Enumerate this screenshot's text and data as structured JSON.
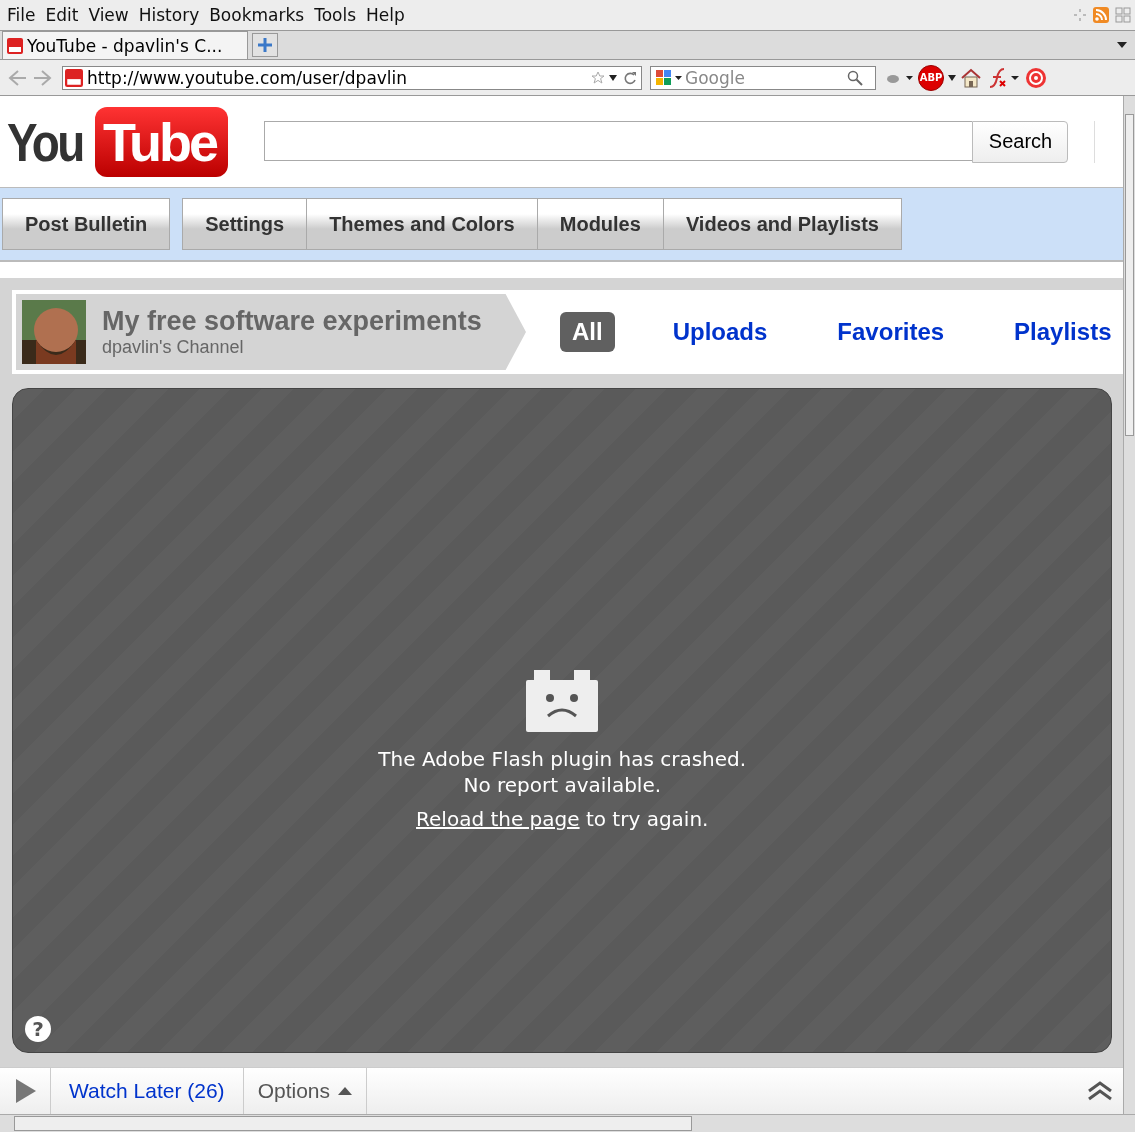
{
  "menu_bar": [
    "File",
    "Edit",
    "View",
    "History",
    "Bookmarks",
    "Tools",
    "Help"
  ],
  "browser_tabs": [
    {
      "title": "YouTube - dpavlin's C...",
      "selected": true
    }
  ],
  "address_bar": {
    "url": "http://www.youtube.com/user/dpavlin"
  },
  "search_bar": {
    "placeholder": "Google"
  },
  "toolbar_badge": "ABP",
  "logo": {
    "part_1": "You",
    "part_2": "Tube"
  },
  "site_search": {
    "button": "Search"
  },
  "edit_buttons": [
    {
      "label": "Post Bulletin"
    },
    {
      "label": "Settings"
    },
    {
      "label": "Themes and Colors"
    },
    {
      "label": "Modules"
    },
    {
      "label": "Videos and Playlists"
    }
  ],
  "channel": {
    "title": "My free software experiments",
    "subtitle": "dpavlin's Channel"
  },
  "channel_tabs": [
    {
      "label": "All",
      "selected": true
    },
    {
      "label": "Uploads",
      "selected": false
    },
    {
      "label": "Favorites",
      "selected": false
    },
    {
      "label": "Playlists",
      "selected": false
    }
  ],
  "player": {
    "message": [
      "The Adobe Flash plugin has crashed.",
      "No report available."
    ],
    "link": "Reload the page",
    "after_link": " to try again.",
    "help": "?"
  },
  "bottom_bar": {
    "watch_later": "Watch Later (26)",
    "options": "Options"
  }
}
